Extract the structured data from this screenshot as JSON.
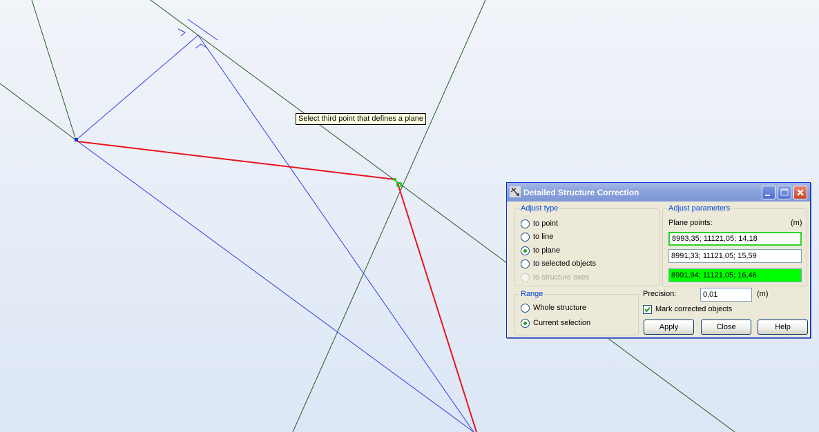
{
  "viewport": {
    "tooltip": "Select third point that defines a plane"
  },
  "dialog": {
    "title": "Detailed Structure Correction",
    "adjust_type": {
      "title": "Adjust type",
      "options": [
        {
          "label": "to point",
          "checked": false,
          "disabled": false
        },
        {
          "label": "to line",
          "checked": false,
          "disabled": false
        },
        {
          "label": "to plane",
          "checked": true,
          "disabled": false
        },
        {
          "label": "to selected objects",
          "checked": false,
          "disabled": false
        },
        {
          "label": "to structure axes",
          "checked": false,
          "disabled": true
        }
      ]
    },
    "adjust_parameters": {
      "title": "Adjust parameters",
      "plane_points_label": "Plane points:",
      "unit": "(m)",
      "points": [
        "8993,35; 11121,05; 14,18",
        "8991,33; 11121,05; 15,59",
        "8991,94; 11121,05; 16,46"
      ]
    },
    "range": {
      "title": "Range",
      "options": [
        {
          "label": "Whole structure",
          "checked": false
        },
        {
          "label": "Current selection",
          "checked": true
        }
      ]
    },
    "precision": {
      "label": "Precision:",
      "value": "0,01",
      "unit": "(m)"
    },
    "mark_corrected": {
      "label": "Mark corrected objects",
      "checked": true
    },
    "buttons": {
      "apply": "Apply",
      "close": "Close",
      "help": "Help"
    }
  },
  "colors": {
    "axis_line": "#1f5a1f",
    "structure_line": "#2b3fe0",
    "selected_line": "#e8141b",
    "highlight_green": "#00ff00"
  }
}
